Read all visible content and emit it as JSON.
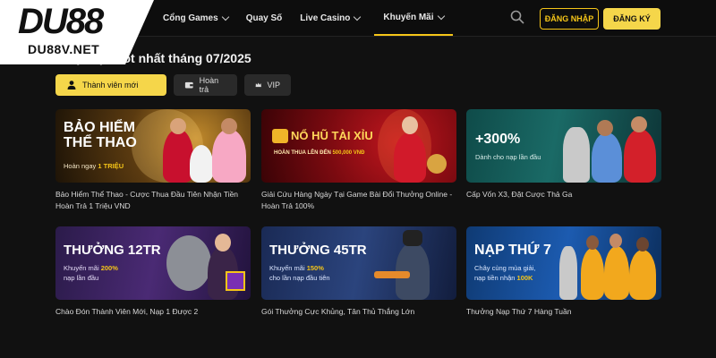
{
  "header": {
    "logo_text": "DU88",
    "logo_domain": "DU88V.NET",
    "nav": [
      {
        "label": "Cổng Games",
        "has_dropdown": true
      },
      {
        "label": "Quay Số",
        "has_dropdown": false
      },
      {
        "label": "Live Casino",
        "has_dropdown": true
      },
      {
        "label": "Khuyến Mãi",
        "has_dropdown": true,
        "active": true
      }
    ],
    "login_label": "ĐĂNG NHẬP",
    "register_label": "ĐĂNG KÝ"
  },
  "section": {
    "title": "a Sự kiện hot nhất tháng 07/2025"
  },
  "tabs": [
    {
      "label": "Thành viên mới",
      "icon": "user-icon",
      "active": true
    },
    {
      "label": "Hoàn trả",
      "icon": "wallet-icon"
    },
    {
      "label": "VIP",
      "icon": "crown-icon"
    }
  ],
  "cards": [
    {
      "banner_title_1": "BẢO HIỂM",
      "banner_title_2": "THỂ THAO",
      "banner_sub_pre": "Hoàn ngay ",
      "banner_sub_hl": "1 TRIỆU",
      "caption": "Bảo Hiểm Thể Thao - Cược Thua Đầu Tiên Nhận Tiền Hoàn Trả 1 Triệu VND"
    },
    {
      "banner_title": "NỔ HŨ TÀI XỈU",
      "banner_sub_pre": "HOÀN THUA LÊN ĐẾN ",
      "banner_sub_hl": "500,000 VNĐ",
      "caption": "Giải Cứu Hàng Ngày Tại Game Bài Đổi Thưởng Online - Hoàn Trả 100%"
    },
    {
      "banner_title": "+300%",
      "banner_sub": "Dành cho nạp lần đầu",
      "caption": "Cấp Vốn X3, Đặt Cược Thả Ga"
    },
    {
      "banner_title": "THƯỞNG 12TR",
      "banner_sub_pre": "Khuyến mãi ",
      "banner_sub_hl": "200%",
      "banner_sub_2": "nạp lần đầu",
      "caption": "Chào Đón Thành Viên Mới, Nạp 1 Được 2"
    },
    {
      "banner_title": "THƯỞNG 45TR",
      "banner_sub_pre": "Khuyến mãi ",
      "banner_sub_hl": "150%",
      "banner_sub_2": "cho lần nạp đầu tiên",
      "caption": "Gói Thưởng Cực Khủng, Tân Thủ Thắng Lớn"
    },
    {
      "banner_title": "NẠP THỨ 7",
      "banner_sub": "Chây cùng mùa giải,",
      "banner_sub_2_pre": "nạp tiền nhận ",
      "banner_sub_2_hl": "100K",
      "caption": "Thưởng Nạp Thứ 7 Hàng Tuần"
    }
  ],
  "colors": {
    "accent": "#f5c518",
    "background": "#111111",
    "tab_bg": "#2a2a2a"
  }
}
